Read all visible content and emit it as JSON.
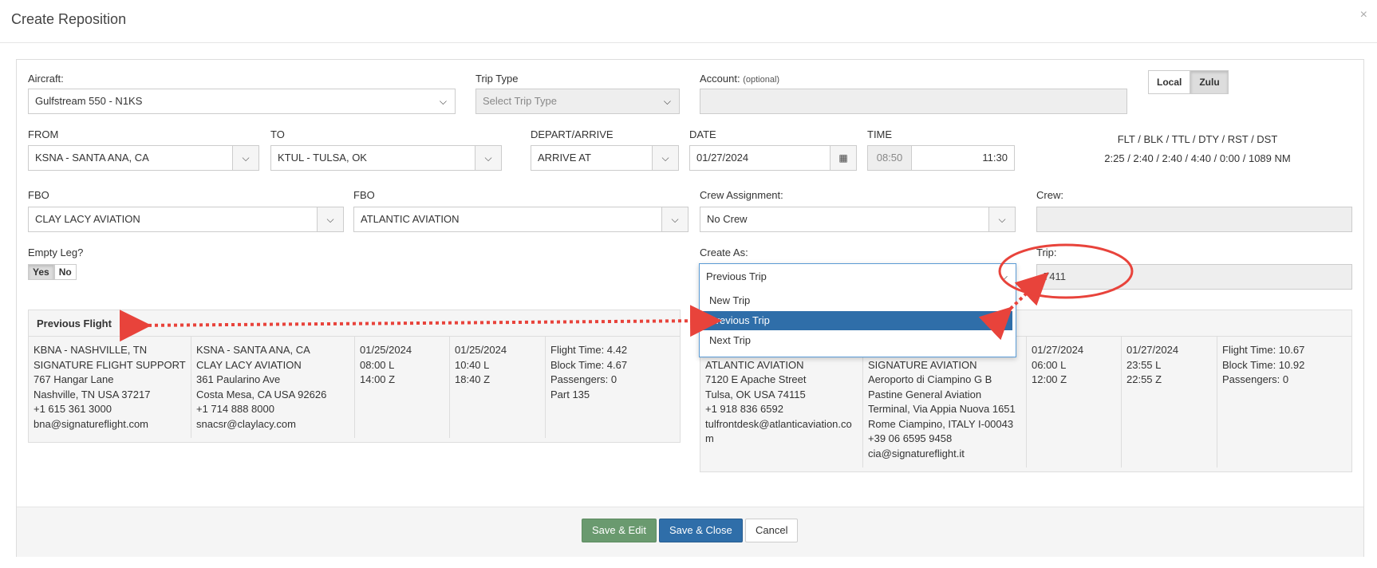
{
  "dialog": {
    "title": "Create Reposition",
    "close": "×"
  },
  "aircraft": {
    "label": "Aircraft:",
    "value": "Gulfstream 550 - N1KS"
  },
  "trip_type": {
    "label": "Trip Type",
    "placeholder": "Select Trip Type"
  },
  "account": {
    "label": "Account:",
    "optional": "(optional)",
    "value": ""
  },
  "time_mode": {
    "options": [
      "Local",
      "Zulu"
    ],
    "active": "Zulu"
  },
  "from": {
    "label": "FROM",
    "value": "KSNA - SANTA ANA, CA"
  },
  "to": {
    "label": "TO",
    "value": "KTUL - TULSA, OK"
  },
  "depart_arrive": {
    "label": "DEPART/ARRIVE",
    "value": "ARRIVE AT"
  },
  "date": {
    "label": "DATE",
    "value": "01/27/2024"
  },
  "time": {
    "label": "TIME",
    "start": "08:50",
    "end": "11:30"
  },
  "flight_info": {
    "header": "FLT / BLK / TTL / DTY / RST / DST",
    "values": "2:25 / 2:40 / 2:40 / 4:40 / 0:00 / 1089 NM"
  },
  "fbo_from": {
    "label": "FBO",
    "value": "CLAY LACY AVIATION"
  },
  "fbo_to": {
    "label": "FBO",
    "value": "ATLANTIC AVIATION"
  },
  "crew_assignment": {
    "label": "Crew Assignment:",
    "value": "No Crew"
  },
  "crew": {
    "label": "Crew:",
    "value": ""
  },
  "empty_leg": {
    "label": "Empty Leg?",
    "options": [
      "Yes",
      "No"
    ],
    "active": "Yes"
  },
  "create_as": {
    "label": "Create As:",
    "value": "Previous Trip",
    "options": [
      "New Trip",
      "Previous Trip",
      "Next Trip"
    ],
    "selected": "Previous Trip"
  },
  "trip": {
    "label": "Trip:",
    "value": "7411"
  },
  "previous_flight": {
    "title": "Previous Flight",
    "cells": [
      [
        "KBNA - NASHVILLE, TN",
        "SIGNATURE FLIGHT SUPPORT",
        "767 Hangar Lane",
        "Nashville, TN USA 37217",
        "+1 615 361 3000",
        "bna@signatureflight.com"
      ],
      [
        "KSNA - SANTA ANA, CA",
        "CLAY LACY AVIATION",
        "361 Paularino Ave",
        "Costa Mesa, CA USA 92626",
        "+1 714 888 8000",
        "snacsr@claylacy.com"
      ],
      [
        "01/25/2024",
        "08:00 L",
        "14:00 Z"
      ],
      [
        "01/25/2024",
        "10:40 L",
        "18:40 Z"
      ],
      [
        "Flight Time: 4.42",
        "Block Time: 4.67",
        "Passengers: 0",
        "Part 135"
      ]
    ]
  },
  "next_flight": {
    "title": "",
    "cells": [
      [
        "",
        "ATLANTIC AVIATION",
        "7120 E Apache Street",
        "Tulsa, OK USA 74115",
        "+1 918 836 6592",
        "tulfrontdesk@atlanticaviation.com"
      ],
      [
        "",
        "SIGNATURE AVIATION",
        "Aeroporto di Ciampino G B Pastine General Aviation Terminal, Via Appia Nuova 1651",
        "Rome Ciampino, ITALY I-00043",
        "+39 06 6595 9458",
        "cia@signatureflight.it"
      ],
      [
        "01/27/2024",
        "06:00 L",
        "12:00 Z"
      ],
      [
        "01/27/2024",
        "23:55 L",
        "22:55 Z"
      ],
      [
        "Flight Time: 10.67",
        "Block Time: 10.92",
        "Passengers: 0"
      ]
    ]
  },
  "footer": {
    "save_edit": "Save & Edit",
    "save_close": "Save & Close",
    "cancel": "Cancel"
  },
  "colors": {
    "primary": "#2f6ea9",
    "success": "#6a9a6f",
    "annotation": "#e8433b"
  }
}
